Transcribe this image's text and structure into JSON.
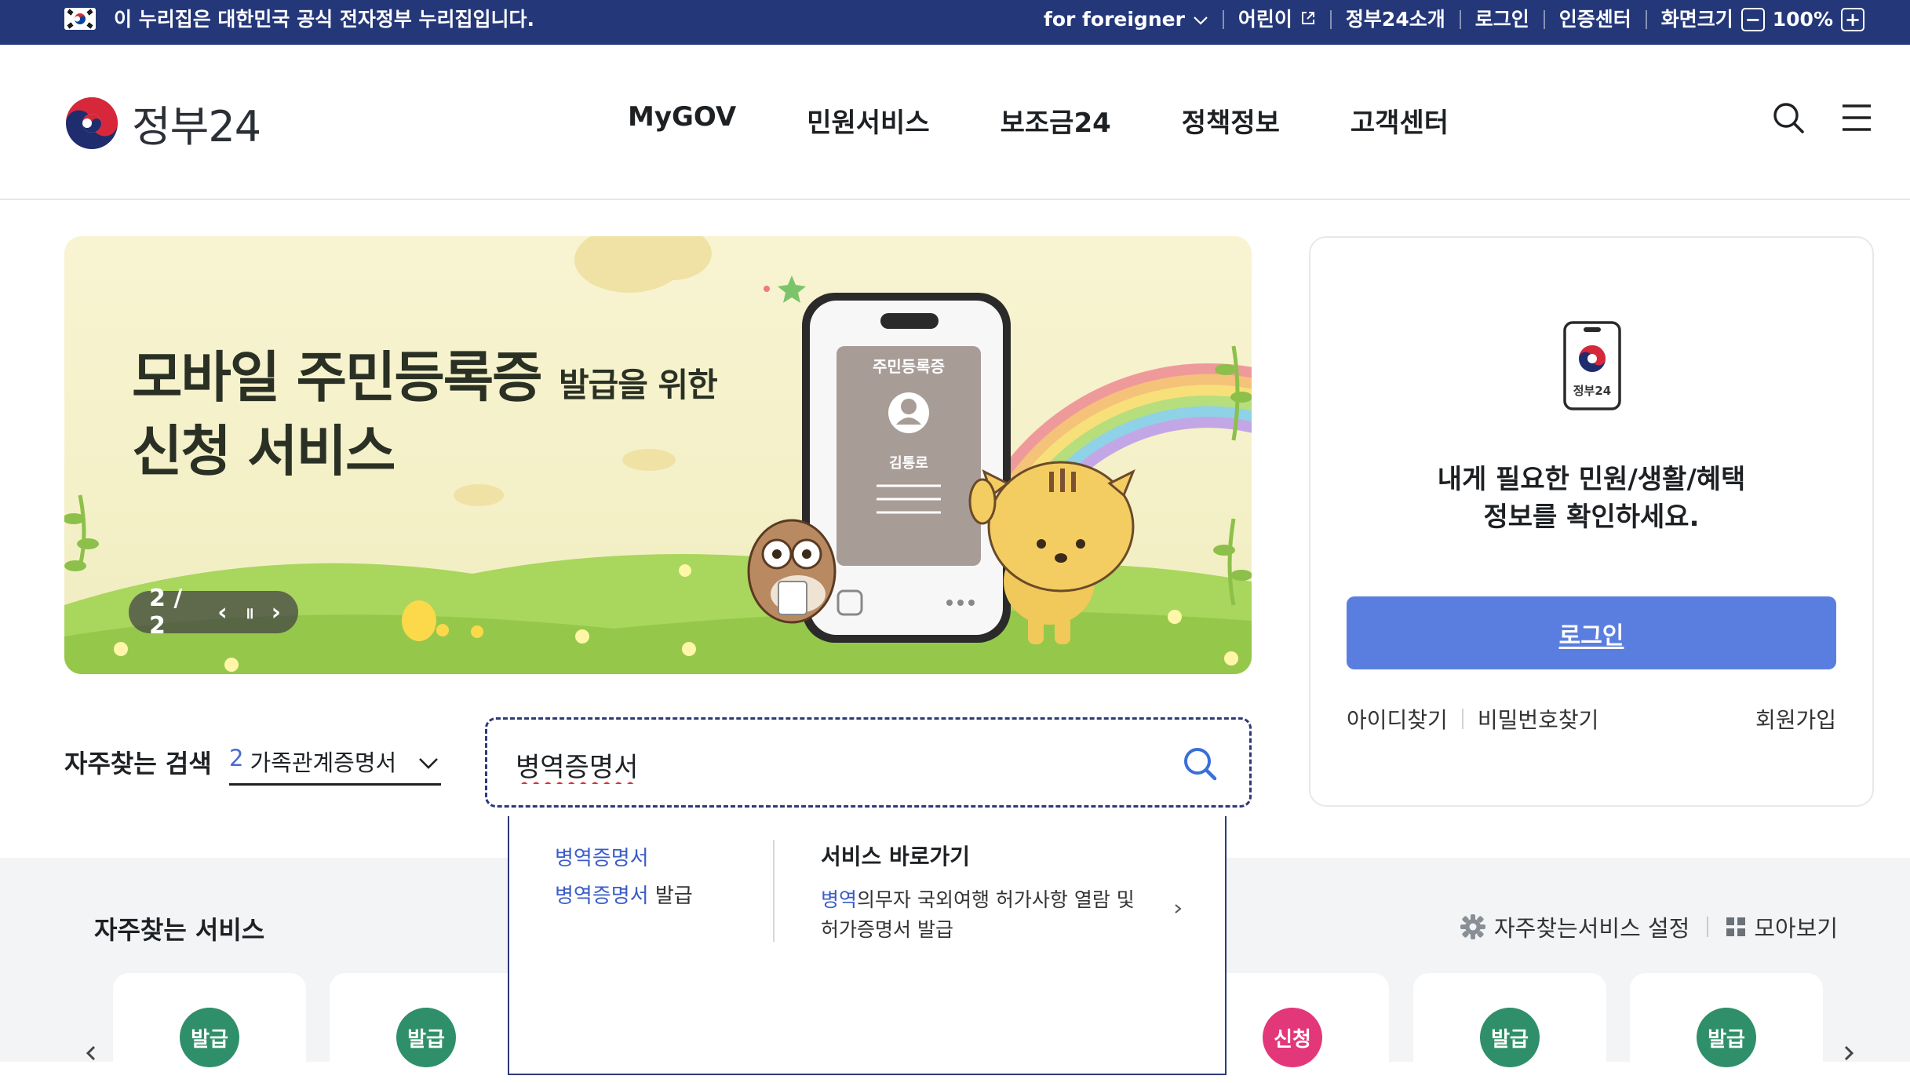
{
  "util_bar": {
    "notice": "이 누리집은 대한민국 공식 전자정부 누리집입니다.",
    "links": [
      {
        "label": "for foreigner",
        "icon": "chevron-down-icon"
      },
      {
        "label": "어린이",
        "icon": "external-link-icon"
      },
      {
        "label": "정부24소개"
      },
      {
        "label": "로그인"
      },
      {
        "label": "인증센터"
      }
    ],
    "zoom": {
      "label": "화면크기",
      "value": "100%",
      "minus": "−",
      "plus": "+"
    }
  },
  "header": {
    "logo_text": "정부24",
    "nav": [
      "MyGOV",
      "민원서비스",
      "보조금24",
      "정책정보",
      "고객센터"
    ]
  },
  "banner": {
    "title_line1": "모바일 주민등록증",
    "title_line1_small": "발급을 위한",
    "title_line2": "신청 서비스",
    "card_title": "주민등록증",
    "card_name": "김통로",
    "pager": "2 / 2",
    "prev": "‹",
    "pause": "॥",
    "next": "›"
  },
  "login": {
    "app_label": "정부24",
    "message_line1": "내게 필요한 민원/생활/혜택",
    "message_line2": "정보를 확인하세요.",
    "button": "로그인",
    "find_id": "아이디찾기",
    "find_pw": "비밀번호찾기",
    "signup": "회원가입"
  },
  "search": {
    "freq_label": "자주찾는 검색",
    "freq_rank": "2",
    "freq_term": "가족관계증명서",
    "query": "병역증명서",
    "suggestions": {
      "left": [
        {
          "match": "병역증명서",
          "rest": ""
        },
        {
          "match": "병역증명서",
          "rest": " 발급"
        }
      ],
      "shortcut_title": "서비스 바로가기",
      "shortcut_match": "병역",
      "shortcut_rest": "의무자 국외여행 허가사항 열람 및 허가증명서 발급"
    }
  },
  "services": {
    "title": "자주찾는 서비스",
    "settings": "자주찾는서비스 설정",
    "view_all": "모아보기",
    "cards": [
      {
        "badge": "발급",
        "color": "#2f8f6b"
      },
      {
        "badge": "발급",
        "color": "#2f8f6b"
      },
      {
        "badge": "신청",
        "color": "#e2387a"
      },
      {
        "badge": "발급",
        "color": "#2f8f6b"
      },
      {
        "badge": "발급",
        "color": "#2f8f6b"
      }
    ]
  },
  "colors": {
    "util_bar": "#243779",
    "accent_blue": "#5a7ee0",
    "link_blue": "#3a5cc8",
    "badge_green": "#2f8f6b",
    "badge_pink": "#e2387a"
  }
}
